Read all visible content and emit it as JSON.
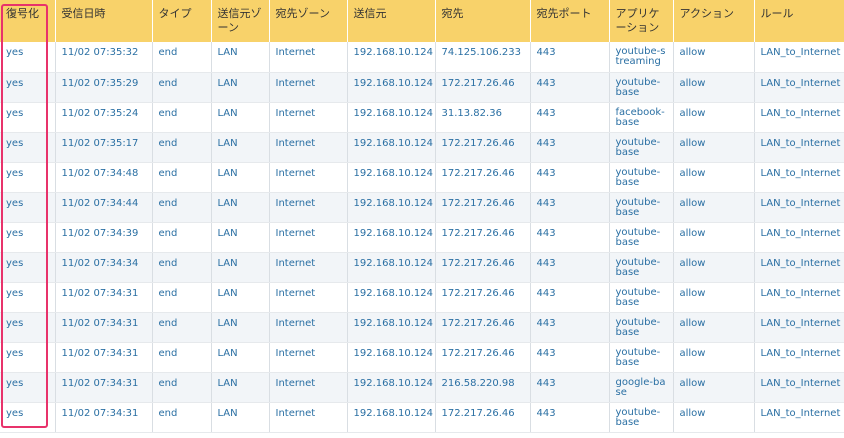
{
  "columns": [
    "復号化",
    "受信日時",
    "タイプ",
    "送信元ゾーン",
    "宛先ゾーン",
    "送信元",
    "宛先",
    "宛先ポート",
    "アプリケーション",
    "アクション",
    "ルール"
  ],
  "rows": [
    [
      "yes",
      "11/02 07:35:32",
      "end",
      "LAN",
      "Internet",
      "192.168.10.124",
      "74.125.106.233",
      "443",
      "youtube-streaming",
      "allow",
      "LAN_to_Internet"
    ],
    [
      "yes",
      "11/02 07:35:29",
      "end",
      "LAN",
      "Internet",
      "192.168.10.124",
      "172.217.26.46",
      "443",
      "youtube-base",
      "allow",
      "LAN_to_Internet"
    ],
    [
      "yes",
      "11/02 07:35:24",
      "end",
      "LAN",
      "Internet",
      "192.168.10.124",
      "31.13.82.36",
      "443",
      "facebook-base",
      "allow",
      "LAN_to_Internet"
    ],
    [
      "yes",
      "11/02 07:35:17",
      "end",
      "LAN",
      "Internet",
      "192.168.10.124",
      "172.217.26.46",
      "443",
      "youtube-base",
      "allow",
      "LAN_to_Internet"
    ],
    [
      "yes",
      "11/02 07:34:48",
      "end",
      "LAN",
      "Internet",
      "192.168.10.124",
      "172.217.26.46",
      "443",
      "youtube-base",
      "allow",
      "LAN_to_Internet"
    ],
    [
      "yes",
      "11/02 07:34:44",
      "end",
      "LAN",
      "Internet",
      "192.168.10.124",
      "172.217.26.46",
      "443",
      "youtube-base",
      "allow",
      "LAN_to_Internet"
    ],
    [
      "yes",
      "11/02 07:34:39",
      "end",
      "LAN",
      "Internet",
      "192.168.10.124",
      "172.217.26.46",
      "443",
      "youtube-base",
      "allow",
      "LAN_to_Internet"
    ],
    [
      "yes",
      "11/02 07:34:34",
      "end",
      "LAN",
      "Internet",
      "192.168.10.124",
      "172.217.26.46",
      "443",
      "youtube-base",
      "allow",
      "LAN_to_Internet"
    ],
    [
      "yes",
      "11/02 07:34:31",
      "end",
      "LAN",
      "Internet",
      "192.168.10.124",
      "172.217.26.46",
      "443",
      "youtube-base",
      "allow",
      "LAN_to_Internet"
    ],
    [
      "yes",
      "11/02 07:34:31",
      "end",
      "LAN",
      "Internet",
      "192.168.10.124",
      "172.217.26.46",
      "443",
      "youtube-base",
      "allow",
      "LAN_to_Internet"
    ],
    [
      "yes",
      "11/02 07:34:31",
      "end",
      "LAN",
      "Internet",
      "192.168.10.124",
      "172.217.26.46",
      "443",
      "youtube-base",
      "allow",
      "LAN_to_Internet"
    ],
    [
      "yes",
      "11/02 07:34:31",
      "end",
      "LAN",
      "Internet",
      "192.168.10.124",
      "216.58.220.98",
      "443",
      "google-base",
      "allow",
      "LAN_to_Internet"
    ],
    [
      "yes",
      "11/02 07:34:31",
      "end",
      "LAN",
      "Internet",
      "192.168.10.124",
      "172.217.26.46",
      "443",
      "youtube-base",
      "allow",
      "LAN_to_Internet"
    ]
  ],
  "colors": {
    "header_background": "#f8d26a",
    "link_text": "#2a6fa3",
    "highlight_border": "#e8326b"
  }
}
